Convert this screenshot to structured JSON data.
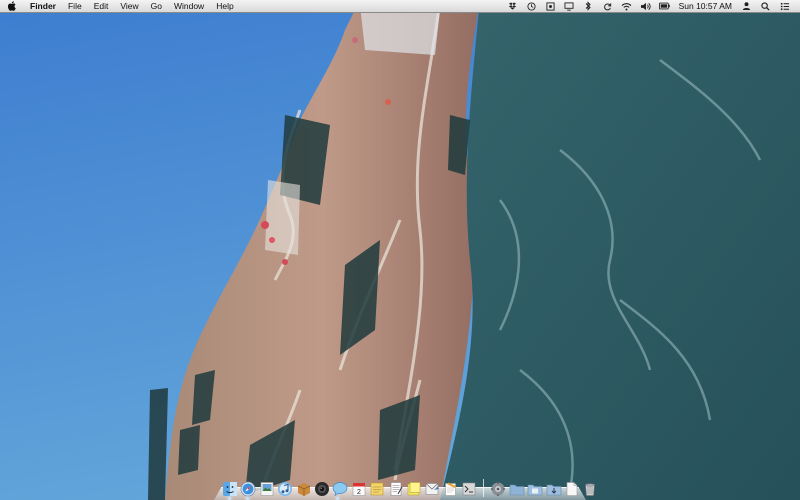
{
  "menubar": {
    "app_name": "Finder",
    "menus": [
      "File",
      "Edit",
      "View",
      "Go",
      "Window",
      "Help"
    ],
    "clock": "Sun 10:57 AM",
    "status_icons": [
      "dropbox-icon",
      "time-machine-icon",
      "screen-sharing-icon",
      "display-icon",
      "bluetooth-icon",
      "sync-icon",
      "wifi-icon",
      "volume-icon",
      "battery-icon",
      "user-icon",
      "spotlight-icon",
      "notification-list-icon"
    ]
  },
  "dock": {
    "apps": [
      "finder-icon",
      "safari-icon",
      "preview-icon",
      "itunes-icon",
      "package-icon",
      "camera-icon",
      "ichat-icon",
      "calendar-icon",
      "notes-icon",
      "textedit-icon",
      "stickies-icon",
      "mail-stamp-icon",
      "pages-icon",
      "script-editor-icon"
    ],
    "others": [
      "system-prefs-icon",
      "applications-folder-icon",
      "documents-folder-icon",
      "downloads-icon",
      "document-icon",
      "trash-icon"
    ],
    "calendar_day": "2"
  },
  "colors": {
    "sky_top": "#3a78c9",
    "sky_bottom": "#5c9fd6",
    "building_warm": "#b78c7a",
    "water_teal": "#2f5e66"
  }
}
